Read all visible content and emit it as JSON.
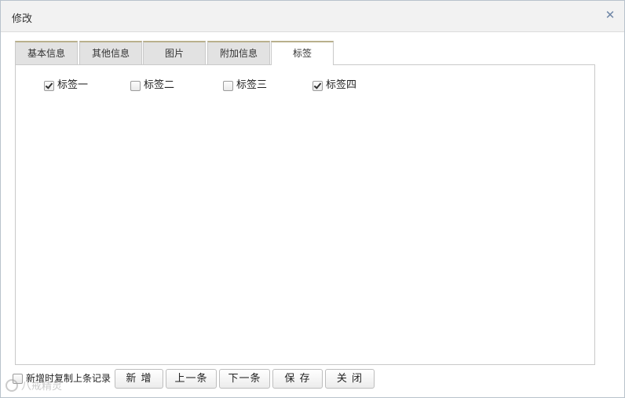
{
  "dialog": {
    "title": "修改",
    "close_icon": "close-icon",
    "accent_color": "#6e86a6"
  },
  "tabs": [
    {
      "label": "基本信息",
      "active": false
    },
    {
      "label": "其他信息",
      "active": false
    },
    {
      "label": "图片",
      "active": false
    },
    {
      "label": "附加信息",
      "active": false
    },
    {
      "label": "标签",
      "active": true
    }
  ],
  "tags": [
    {
      "label": "标签一",
      "checked": true
    },
    {
      "label": "标签二",
      "checked": false
    },
    {
      "label": "标签三",
      "checked": false
    },
    {
      "label": "标签四",
      "checked": true
    }
  ],
  "footer": {
    "copy_last_label": "新增时复制上条记录",
    "copy_last_checked": false,
    "buttons": {
      "new": "新 增",
      "prev": "上一条",
      "next": "下一条",
      "save": "保 存",
      "close": "关 闭"
    }
  },
  "watermark": "八戒精灵"
}
